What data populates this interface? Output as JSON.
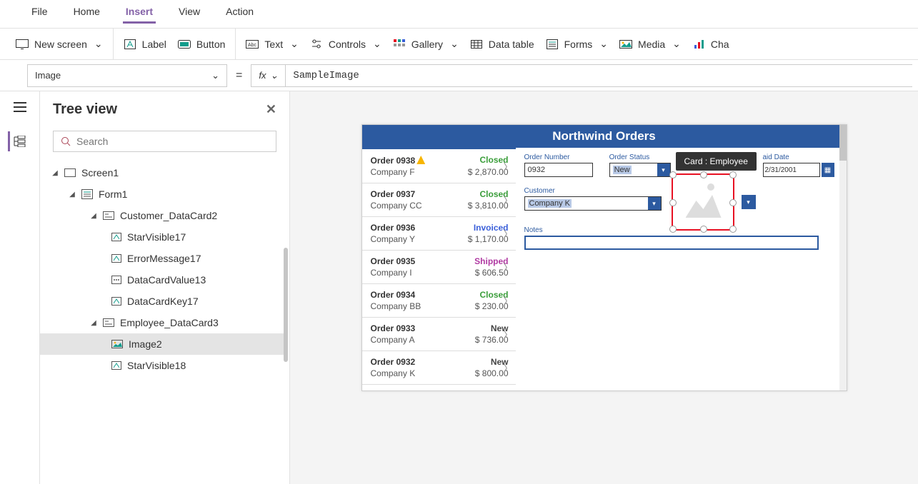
{
  "menubar": {
    "items": [
      "File",
      "Home",
      "Insert",
      "View",
      "Action"
    ],
    "active": "Insert"
  },
  "ribbon": {
    "new_screen": "New screen",
    "label": "Label",
    "button": "Button",
    "text": "Text",
    "controls": "Controls",
    "gallery": "Gallery",
    "data_table": "Data table",
    "forms": "Forms",
    "media": "Media",
    "charts": "Cha"
  },
  "formula": {
    "property": "Image",
    "fx_label": "fx",
    "value": "SampleImage"
  },
  "panel": {
    "title": "Tree view",
    "search_placeholder": "Search",
    "tree": {
      "screen": "Screen1",
      "form": "Form1",
      "card1": "Customer_DataCard2",
      "leaf1": "StarVisible17",
      "leaf2": "ErrorMessage17",
      "leaf3": "DataCardValue13",
      "leaf4": "DataCardKey17",
      "card2": "Employee_DataCard3",
      "leaf5": "Image2",
      "leaf6": "StarVisible18"
    }
  },
  "app": {
    "title": "Northwind Orders",
    "orders": [
      {
        "num": "Order 0938",
        "company": "Company F",
        "status": "Closed",
        "amount": "$ 2,870.00",
        "warn": true
      },
      {
        "num": "Order 0937",
        "company": "Company CC",
        "status": "Closed",
        "amount": "$ 3,810.00"
      },
      {
        "num": "Order 0936",
        "company": "Company Y",
        "status": "Invoiced",
        "amount": "$ 1,170.00"
      },
      {
        "num": "Order 0935",
        "company": "Company I",
        "status": "Shipped",
        "amount": "$ 606.50"
      },
      {
        "num": "Order 0934",
        "company": "Company BB",
        "status": "Closed",
        "amount": "$ 230.00"
      },
      {
        "num": "Order 0933",
        "company": "Company A",
        "status": "New",
        "amount": "$ 736.00"
      },
      {
        "num": "Order 0932",
        "company": "Company K",
        "status": "New",
        "amount": "$ 800.00"
      }
    ],
    "detail": {
      "labels": {
        "order_number": "Order Number",
        "order_status": "Order Status",
        "paid_date": "aid Date",
        "customer": "Customer",
        "notes": "Notes"
      },
      "values": {
        "order_number": "0932",
        "order_status": "New",
        "customer": "Company K",
        "paid_date": "2/31/2001"
      }
    },
    "tooltip": "Card : Employee"
  }
}
